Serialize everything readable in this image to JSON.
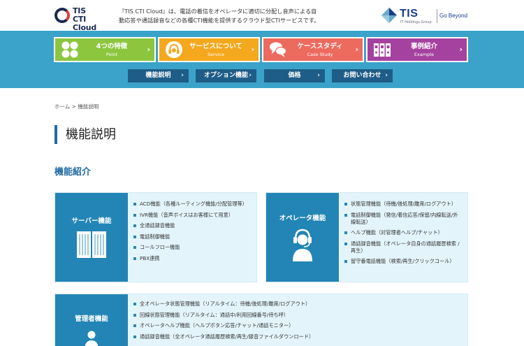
{
  "header": {
    "logo_line1": "TIS",
    "logo_line2": "CTI Cloud",
    "tagline": "『TIS CTI Cloud』は、電話の着信をオペレータに適切に分配し音声による自動応答や通話録音などの各種CTI機能を提供するクラウド型CTIサービスです。",
    "corp_name": "TIS",
    "corp_sub": "IT Holdings Group",
    "corp_slogan": "Go Beyond"
  },
  "colors": {
    "band": "#3ba3c9",
    "tile_point": "#8cc63f",
    "tile_service": "#f4a81d",
    "tile_case": "#ec6a5e",
    "tile_example": "#a5419f",
    "subnav": "#1e5d87",
    "panel_head": "#2385b5",
    "panel_bg": "#e3f5fb",
    "accent": "#1f6aa5"
  },
  "main_nav": [
    {
      "title": "4つの特徴",
      "sub": "Point",
      "icon": "four-circles-icon"
    },
    {
      "title": "サービスについて",
      "sub": "Service",
      "icon": "headset-icon"
    },
    {
      "title": "ケーススタディ",
      "sub": "Case Study",
      "icon": "speech-bubbles-icon"
    },
    {
      "title": "事例紹介",
      "sub": "Example",
      "icon": "binders-icon"
    }
  ],
  "sub_nav": [
    {
      "label": "機能説明"
    },
    {
      "label": "オプション機能"
    },
    {
      "label": "価格"
    },
    {
      "label": "お問い合わせ"
    }
  ],
  "breadcrumb": {
    "home": "ホーム",
    "separator": ">",
    "current": "機能説明"
  },
  "page_title": "機能説明",
  "section_title": "機能紹介",
  "panels": {
    "server": {
      "label": "サーバー機能",
      "icon": "server-rack-icon",
      "items": [
        "ACD機能（各種ルーティング機能/分配管理等）",
        "IVR機能（音声ボイスはお客様にて用意）",
        "全通話録音機能",
        "電話制御機能",
        "コールフロー機能",
        "PBX連携"
      ]
    },
    "operator": {
      "label": "オペレータ機能",
      "icon": "operator-headset-icon",
      "items": [
        "状態管理機能（待機/後処理/離席/ログアウト）",
        "電話制御機能（発信/着信応答/保留/内線転送/外線転送）",
        "ヘルプ機能（対管理者ヘルプ/チャット）",
        "通話録音機能（オペレータ自身の通話履歴検索 /再生）",
        "留守番電話機能（検索/再生/クリックコール）"
      ]
    },
    "admin": {
      "label": "管理者機能",
      "icon": "admin-person-icon",
      "items": [
        "全オペレータ状態管理機能（リアルタイム：待機/後処理/離席/ログアウト）",
        "回線状態管理機能（リアルタイム：通話中/利用回線番号/待ち呼）",
        "オペレータヘルプ機能（ヘルプボタン応答/チャット/通話モニター）",
        "通話録音機能（全オペレータ通話履歴検索/再生/録音ファイルダウンロード）"
      ]
    }
  }
}
